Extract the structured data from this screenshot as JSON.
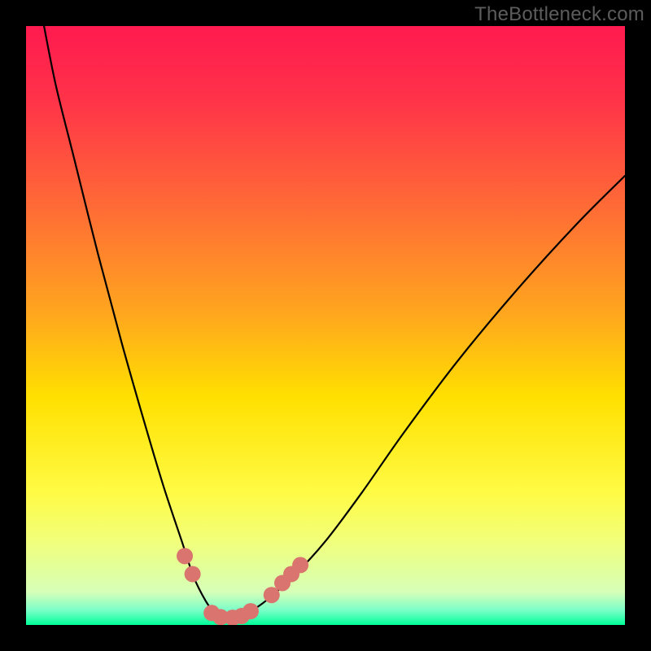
{
  "watermark": "TheBottleneck.com",
  "colors": {
    "frame": "#000000",
    "gradient_stops": [
      {
        "offset": 0.0,
        "color": "#ff1a4f"
      },
      {
        "offset": 0.12,
        "color": "#ff3249"
      },
      {
        "offset": 0.3,
        "color": "#ff6a36"
      },
      {
        "offset": 0.48,
        "color": "#ffa61e"
      },
      {
        "offset": 0.62,
        "color": "#ffe000"
      },
      {
        "offset": 0.78,
        "color": "#fffb45"
      },
      {
        "offset": 0.86,
        "color": "#f1ff7a"
      },
      {
        "offset": 0.945,
        "color": "#d6ffb8"
      },
      {
        "offset": 0.975,
        "color": "#7cffc8"
      },
      {
        "offset": 1.0,
        "color": "#00ff99"
      }
    ],
    "curve": "#000000",
    "marker_fill": "#d9746e",
    "marker_stroke": "#d9746e"
  },
  "chart_data": {
    "type": "line",
    "title": "",
    "xlabel": "",
    "ylabel": "",
    "xlim": [
      0,
      100
    ],
    "ylim": [
      0,
      100
    ],
    "series": [
      {
        "name": "bottleneck-curve",
        "x": [
          3,
          5,
          8,
          12,
          16,
          20,
          23,
          26,
          28,
          30,
          31.5,
          33,
          35,
          37,
          40,
          45,
          50,
          56,
          63,
          72,
          82,
          92,
          100
        ],
        "y": [
          100,
          90,
          78,
          62,
          47,
          33,
          23,
          14,
          8,
          4,
          2,
          1,
          1,
          2,
          4,
          8.5,
          14,
          22,
          32,
          44,
          56,
          67,
          75
        ]
      }
    ],
    "markers": [
      {
        "x": 26.5,
        "y": 11.5
      },
      {
        "x": 27.8,
        "y": 8.5
      },
      {
        "x": 31.0,
        "y": 2.0
      },
      {
        "x": 32.5,
        "y": 1.3
      },
      {
        "x": 34.5,
        "y": 1.2
      },
      {
        "x": 36.0,
        "y": 1.5
      },
      {
        "x": 37.5,
        "y": 2.3
      },
      {
        "x": 41.0,
        "y": 5.0
      },
      {
        "x": 42.8,
        "y": 7.0
      },
      {
        "x": 44.3,
        "y": 8.5
      },
      {
        "x": 45.8,
        "y": 10.0
      }
    ]
  }
}
